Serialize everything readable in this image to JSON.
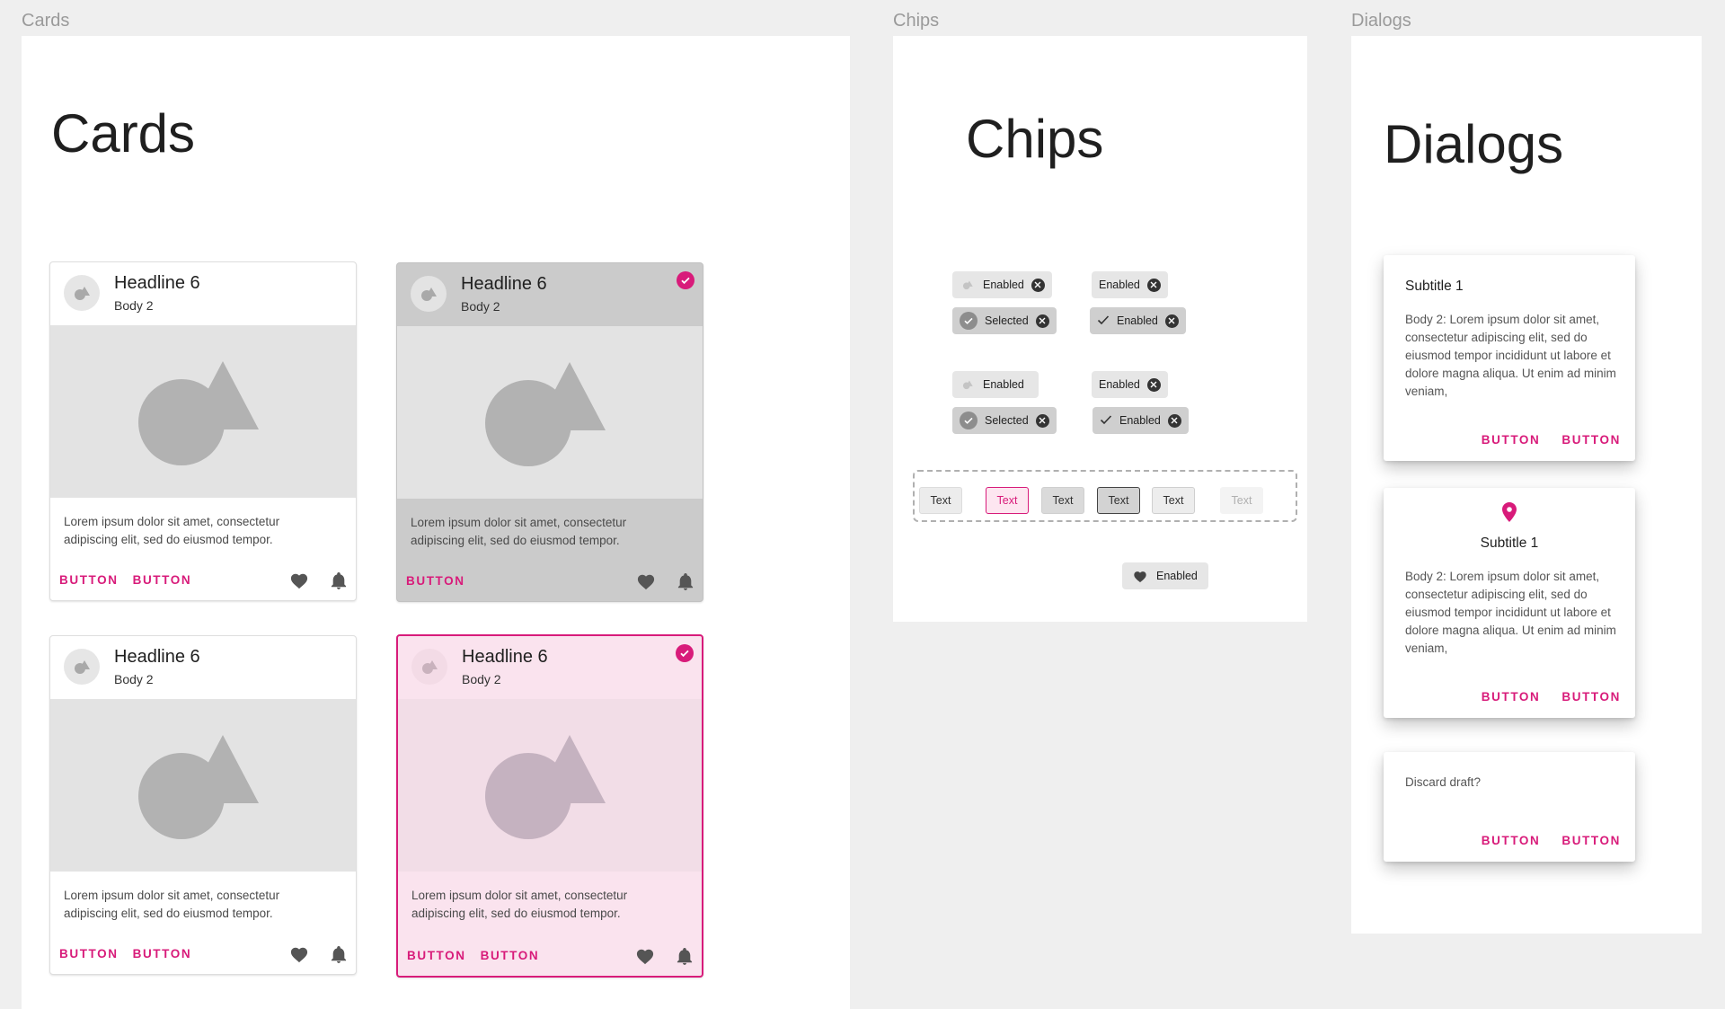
{
  "frames": {
    "cards": {
      "label": "Cards",
      "title": "Cards"
    },
    "chips": {
      "label": "Chips",
      "title": "Chips"
    },
    "dialogs": {
      "label": "Dialogs",
      "title": "Dialogs"
    }
  },
  "cards": [
    {
      "headline": "Headline 6",
      "body2": "Body 2",
      "text": "Lorem ipsum dolor sit amet, consectetur adipiscing elit, sed do eiusmod tempor.",
      "buttons": [
        "BUTTON",
        "BUTTON"
      ],
      "state": "enabled"
    },
    {
      "headline": "Headline 6",
      "body2": "Body 2",
      "text": "Lorem ipsum dolor sit amet, consectetur adipiscing elit, sed do eiusmod tempor.",
      "buttons": [
        "BUTTON"
      ],
      "state": "selected"
    },
    {
      "headline": "Headline 6",
      "body2": "Body 2",
      "text": "Lorem ipsum dolor sit amet, consectetur adipiscing elit, sed do eiusmod tempor.",
      "buttons": [
        "BUTTON",
        "BUTTON"
      ],
      "state": "enabled"
    },
    {
      "headline": "Headline 6",
      "body2": "Body 2",
      "text": "Lorem ipsum dolor sit amet, consectetur adipiscing elit, sed do eiusmod tempor.",
      "buttons": [
        "BUTTON",
        "BUTTON"
      ],
      "state": "selected-pink"
    }
  ],
  "chips": {
    "input_rows": [
      {
        "label": "Enabled"
      },
      {
        "label": "Enabled"
      },
      {
        "label": "Selected"
      },
      {
        "label": "Enabled"
      },
      {
        "label": "Enabled"
      },
      {
        "label": "Enabled"
      },
      {
        "label": "Selected"
      },
      {
        "label": "Enabled"
      }
    ],
    "choice_group": [
      "Text",
      "Text",
      "Text",
      "Text",
      "Text",
      "Text"
    ],
    "action_chip": "Enabled"
  },
  "dialogs": [
    {
      "subtitle": "Subtitle 1",
      "body": "Body 2: Lorem ipsum dolor sit amet, consectetur adipiscing elit, sed do eiusmod tempor incididunt ut labore et dolore magna aliqua. Ut enim ad minim veniam,",
      "buttons": [
        "BUTTON",
        "BUTTON"
      ]
    },
    {
      "subtitle": "Subtitle 1",
      "body": "Body 2: Lorem ipsum dolor sit amet, consectetur adipiscing elit, sed do eiusmod tempor incididunt ut labore et dolore magna aliqua. Ut enim ad minim veniam,",
      "buttons": [
        "BUTTON",
        "BUTTON"
      ]
    },
    {
      "body": "Discard draft?",
      "buttons": [
        "BUTTON",
        "BUTTON"
      ]
    }
  ],
  "colors": {
    "accent": "#d81b7a",
    "frame_bg": "#ffffff",
    "canvas_bg": "#efefef"
  }
}
